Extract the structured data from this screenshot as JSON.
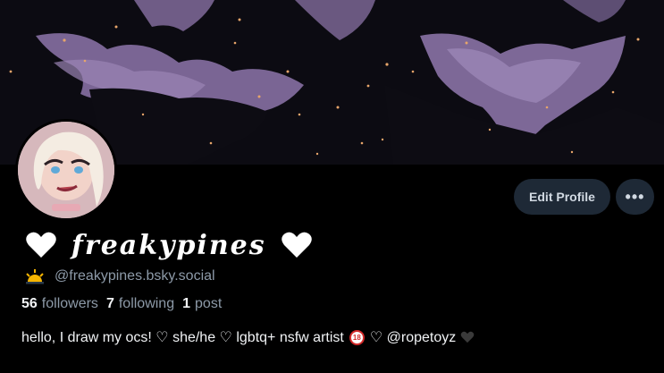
{
  "profile": {
    "display_name": "freakypines",
    "handle": "@freakypines.bsky.social",
    "stats": [
      {
        "count": "56",
        "label": "followers"
      },
      {
        "count": "7",
        "label": "following"
      },
      {
        "count": "1",
        "label": "post"
      }
    ],
    "bio": {
      "part1": "hello, I draw my ocs! ♡ she/he ♡ lgbtq+ nsfw artist",
      "badge": "18",
      "part2": "♡ @ropetoyz"
    }
  },
  "actions": {
    "edit_profile_label": "Edit Profile",
    "more_label": "•••"
  },
  "icons": {
    "name_decoration": "white-heart-icon",
    "handle_emoji": "sunrise-icon",
    "bio_badge": "no-under-18-icon",
    "bio_end": "black-heart-icon"
  },
  "colors": {
    "background": "#000000",
    "button_bg": "#1e2936",
    "muted_text": "#8d9aa8",
    "primary_text": "#f1f3f5"
  }
}
